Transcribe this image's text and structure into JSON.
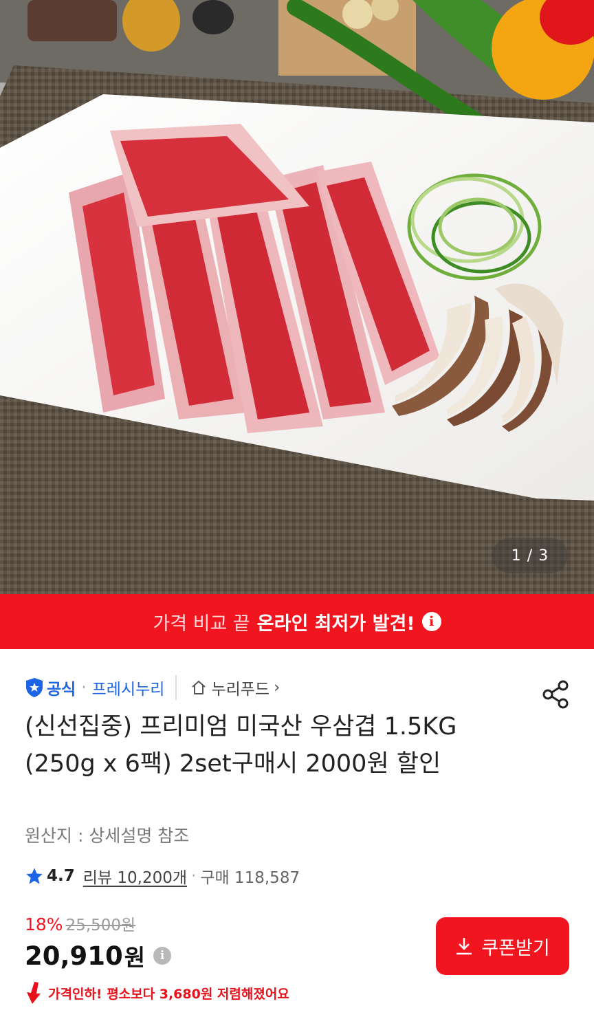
{
  "gallery": {
    "counter": "1 / 3"
  },
  "banner": {
    "light_text": "가격 비교 끝",
    "bold_text": "온라인 최저가 발견!",
    "info_icon": "i"
  },
  "seller": {
    "badge_label": "공식",
    "separator": "·",
    "store_name": "프레시누리",
    "brand_name": "누리푸드",
    "brand_chevron": "›"
  },
  "product": {
    "title": "(신선집중) 프리미엄 미국산 우삼겹 1.5KG (250g x 6팩) 2set구매시 2000원 할인",
    "origin": "원산지 : 상세설명 참조"
  },
  "rating": {
    "score": "4.7",
    "reviews": "리뷰 10,200개",
    "separator": "·",
    "purchases": "구매 118,587"
  },
  "price": {
    "discount_rate": "18%",
    "original_price": "25,500원",
    "sale_price": "20,910",
    "sale_unit": "원",
    "info_icon": "i",
    "drop_notice": "가격인하! 평소보다 3,680원 저렴해졌어요"
  },
  "coupon": {
    "label": "쿠폰받기"
  },
  "colors": {
    "accent_red": "#f0151f",
    "official_blue": "#1e64e6",
    "star_blue": "#1e64e6"
  },
  "icons": {
    "share": "share-icon",
    "home": "home-icon",
    "star": "star-icon",
    "download": "download-icon",
    "badge": "shield-star-icon",
    "price_drop": "arrow-down-icon"
  }
}
